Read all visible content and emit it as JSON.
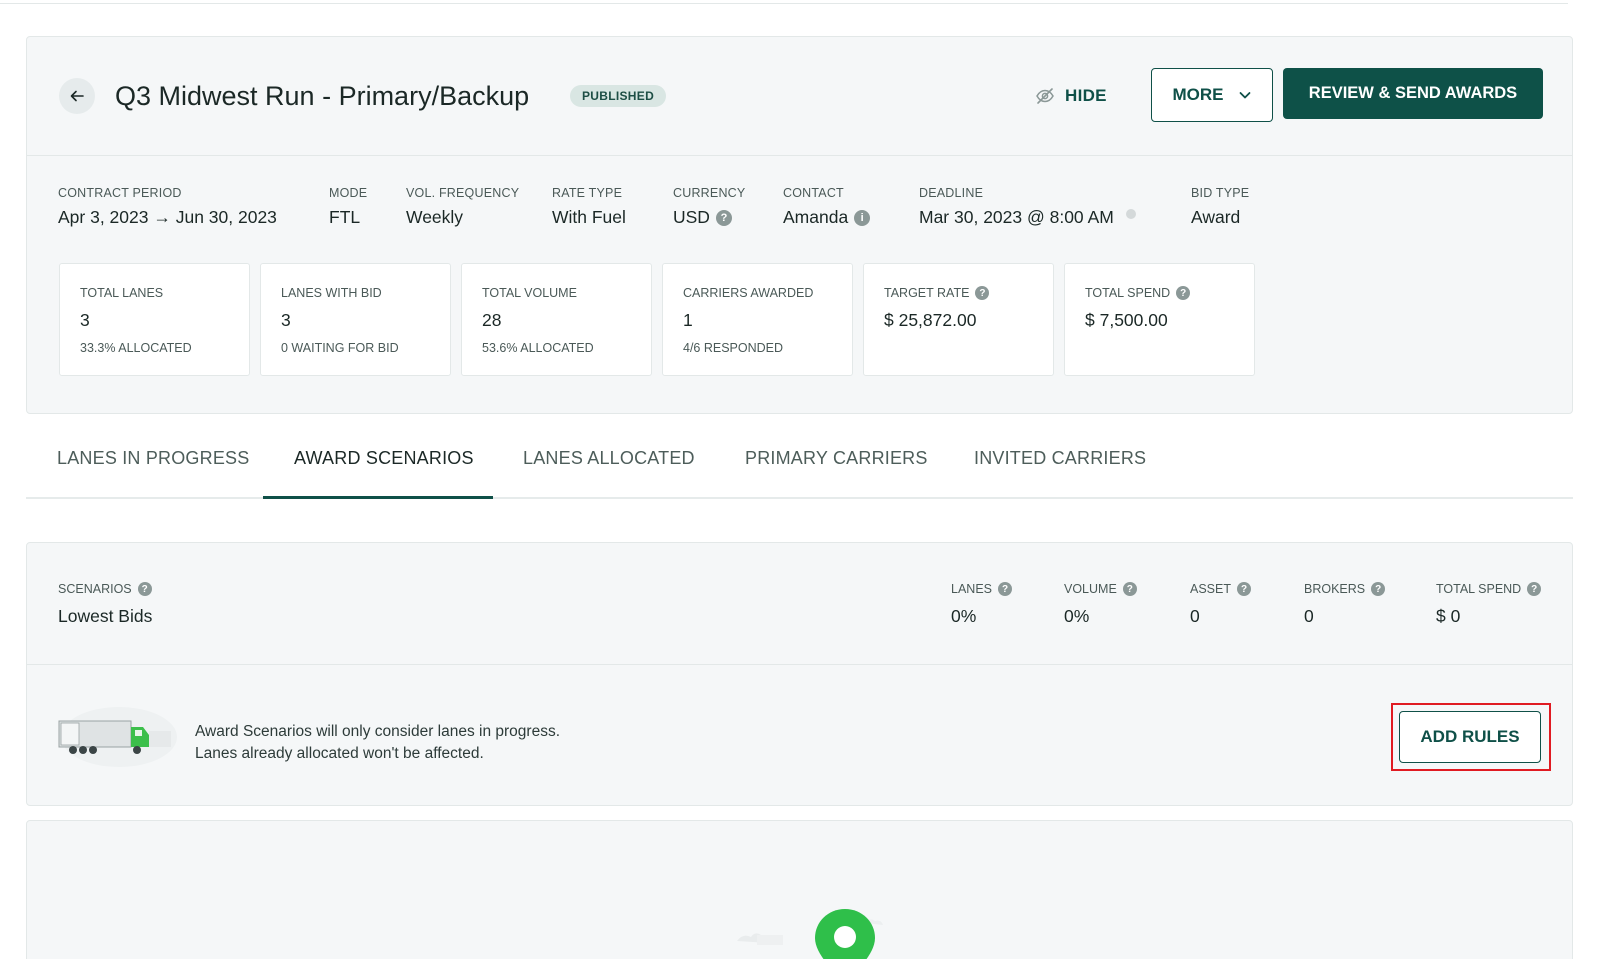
{
  "header": {
    "title": "Q3 Midwest Run - Primary/Backup",
    "status": "PUBLISHED",
    "hide_label": "HIDE",
    "more_label": "MORE",
    "review_label": "REVIEW & SEND AWARDS"
  },
  "meta": [
    {
      "label": "CONTRACT PERIOD",
      "value": "Apr 3, 2023 → Jun 30, 2023"
    },
    {
      "label": "MODE",
      "value": "FTL"
    },
    {
      "label": "VOL. FREQUENCY",
      "value": "Weekly"
    },
    {
      "label": "RATE TYPE",
      "value": "With Fuel"
    },
    {
      "label": "CURRENCY",
      "value": "USD"
    },
    {
      "label": "CONTACT",
      "value": "Amanda"
    },
    {
      "label": "DEADLINE",
      "value": "Mar 30, 2023 @ 8:00 AM"
    },
    {
      "label": "BID TYPE",
      "value": "Award"
    }
  ],
  "stats": [
    {
      "label": "TOTAL LANES",
      "value": "3",
      "sub": "33.3% ALLOCATED"
    },
    {
      "label": "LANES WITH BID",
      "value": "3",
      "sub": "0 WAITING FOR BID"
    },
    {
      "label": "TOTAL VOLUME",
      "value": "28",
      "sub": "53.6% ALLOCATED"
    },
    {
      "label": "CARRIERS AWARDED",
      "value": "1",
      "sub": "4/6 RESPONDED"
    },
    {
      "label": "TARGET RATE",
      "value": "$ 25,872.00",
      "sub": ""
    },
    {
      "label": "TOTAL SPEND",
      "value": "$ 7,500.00",
      "sub": ""
    }
  ],
  "tabs": [
    {
      "label": "LANES IN PROGRESS"
    },
    {
      "label": "AWARD SCENARIOS"
    },
    {
      "label": "LANES ALLOCATED"
    },
    {
      "label": "PRIMARY CARRIERS"
    },
    {
      "label": "INVITED CARRIERS"
    }
  ],
  "scenario": {
    "scenarios_label": "SCENARIOS",
    "scenarios_value": "Lowest Bids",
    "columns": [
      {
        "label": "LANES",
        "value": "0%"
      },
      {
        "label": "VOLUME",
        "value": "0%"
      },
      {
        "label": "ASSET",
        "value": "0"
      },
      {
        "label": "BROKERS",
        "value": "0"
      },
      {
        "label": "TOTAL SPEND",
        "value": "$ 0"
      }
    ],
    "notice_line1": "Award Scenarios will only consider lanes in progress.",
    "notice_line2": "Lanes already allocated won't be affected.",
    "add_rules_label": "ADD RULES"
  },
  "colors": {
    "primary": "#0e5148",
    "highlight": "#e01b22",
    "panel_bg": "#f5f7f8"
  }
}
